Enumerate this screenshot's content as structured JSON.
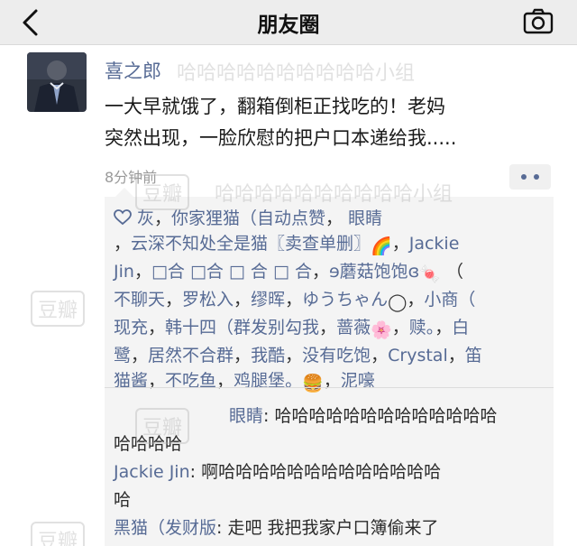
{
  "header": {
    "title": "朋友圈",
    "back_icon": "chevron-left-icon",
    "camera_icon": "camera-icon"
  },
  "post": {
    "author": "喜之郎",
    "text_line1": "一大早就饿了，翻箱倒柜正找吃的！老妈",
    "text_line2": "突然出现，一脸欣慰的把户口本递给我.....",
    "time": "8分钟前"
  },
  "likes": {
    "heart_icon": "heart-outline-icon",
    "names": [
      "灰",
      "你家狸猫（自动点赞",
      "眼睛",
      "云深不知处全是猫〖卖查单删〗🌈",
      "Jackie Jin",
      "□合 □合 □ 合 □ 合",
      "ɘ蘑菇饱饱ɞ🍬",
      "（不聊天",
      "罗松入",
      "缪晖",
      "ゆうちゃん◯",
      "小商（现充",
      "韩十四（群发别勾我",
      "蔷薇🌸",
      "赎。",
      "白鹭",
      "居然不合群",
      "我酷",
      "没有吃饱",
      "Crystal",
      "笛猫酱",
      "不吃鱼",
      "鸡腿堡。🍔",
      "泥嚎"
    ],
    "display_lines": [
      {
        "parts": [
          [
            "name",
            "灰"
          ],
          [
            "sep",
            "，"
          ],
          [
            "name",
            "你家狸猫（自动点赞"
          ],
          [
            "sep",
            "，"
          ],
          [
            "name",
            "                 眼睛"
          ]
        ]
      },
      {
        "parts": [
          [
            "sep",
            "，"
          ],
          [
            "name",
            "云深不知处全是猫〖卖查单删〗"
          ],
          [
            "emoji",
            "🌈"
          ],
          [
            "sep",
            "，"
          ],
          [
            "name",
            "Jackie"
          ]
        ]
      },
      {
        "parts": [
          [
            "name",
            "Jin"
          ],
          [
            "sep",
            "，"
          ],
          [
            "name",
            "□合 □合  □ 合   □ 合"
          ],
          [
            "sep",
            "，"
          ],
          [
            "name",
            "ɘ蘑菇饱饱ɞ"
          ],
          [
            "emoji",
            "🍬"
          ],
          [
            "sep",
            "   （"
          ]
        ]
      },
      {
        "parts": [
          [
            "name",
            "不聊天"
          ],
          [
            "sep",
            "，"
          ],
          [
            "name",
            "罗松入"
          ],
          [
            "sep",
            "，"
          ],
          [
            "name",
            "缪晖"
          ],
          [
            "sep",
            "，"
          ],
          [
            "name",
            "ゆうちゃん"
          ],
          [
            "emoji",
            "◯"
          ],
          [
            "sep",
            "，"
          ],
          [
            "name",
            "小商（"
          ]
        ]
      },
      {
        "parts": [
          [
            "name",
            "现充"
          ],
          [
            "sep",
            "，"
          ],
          [
            "name",
            "韩十四（群发别勾我"
          ],
          [
            "sep",
            "，"
          ],
          [
            "name",
            "蔷薇"
          ],
          [
            "emoji",
            "🌸"
          ],
          [
            "sep",
            "，"
          ],
          [
            "name",
            "赎。"
          ],
          [
            "sep",
            "，"
          ],
          [
            "name",
            "白"
          ]
        ]
      },
      {
        "parts": [
          [
            "name",
            "鹭"
          ],
          [
            "sep",
            "，"
          ],
          [
            "name",
            "居然不合群"
          ],
          [
            "sep",
            "，"
          ],
          [
            "name",
            "我酷"
          ],
          [
            "sep",
            "，"
          ],
          [
            "name",
            "没有吃饱"
          ],
          [
            "sep",
            "，"
          ],
          [
            "name",
            "Crystal"
          ],
          [
            "sep",
            "，"
          ],
          [
            "name",
            "笛"
          ]
        ]
      },
      {
        "parts": [
          [
            "name",
            "猫酱"
          ],
          [
            "sep",
            "，"
          ],
          [
            "name",
            "不吃鱼"
          ],
          [
            "sep",
            "，"
          ],
          [
            "name",
            "鸡腿堡。"
          ],
          [
            "emoji",
            "🍔"
          ],
          [
            "sep",
            "，"
          ],
          [
            "name",
            "泥嚎"
          ]
        ]
      }
    ]
  },
  "comments": [
    {
      "author": "眼睛",
      "sep": ": ",
      "text_line1": "哈哈哈哈哈哈哈哈哈哈哈哈哈",
      "text_line2": "哈哈哈哈"
    },
    {
      "author": "Jackie Jin",
      "sep": ": ",
      "text_line1": "啊哈哈哈哈哈哈哈哈哈哈哈哈哈",
      "text_line2": "哈"
    },
    {
      "author": "黑猫（发财版",
      "sep": ": ",
      "text_line1": "走吧 我把我家户口簿偷来了",
      "text_line2": ""
    }
  ],
  "watermarks": {
    "group_text": "哈哈哈哈哈哈哈哈哈哈小组",
    "badge_text": "豆瓣"
  },
  "colors": {
    "link": "#576b95",
    "header_bg": "#ededed",
    "feedback_bg": "#f4f4f4"
  }
}
